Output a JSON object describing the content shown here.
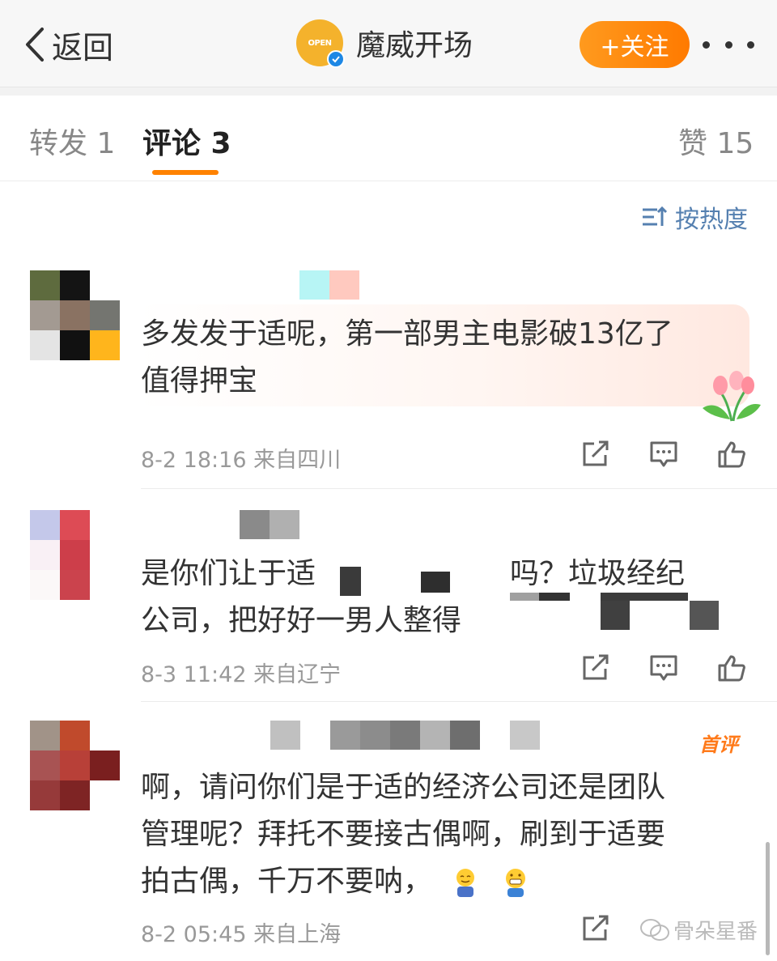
{
  "nav": {
    "back_label": "返回",
    "account_name": "魔威开场",
    "logo_text": "OPEN",
    "follow_label": "+关注"
  },
  "tabs": [
    {
      "label": "转发 1"
    },
    {
      "label": "评论 3"
    },
    {
      "label": "赞 15"
    }
  ],
  "sort_label": "按热度",
  "comments": [
    {
      "lines": [
        "多发发于适呢，第一部男主电影破13亿了",
        "值得押宝"
      ],
      "meta": "8-2 18:16 来自四川"
    },
    {
      "lines": [
        "是你们让于适",
        "公司，把好好一男人整得"
      ],
      "line1_tail": "吗？垃圾经纪",
      "meta": "8-3 11:42 来自辽宁"
    },
    {
      "lines": [
        "啊，请问你们是于适的经济公司还是团队",
        "管理呢？拜托不要接古偶啊，刷到于适要",
        "拍古偶，千万不要呐，"
      ],
      "meta": "8-2 05:45 来自上海",
      "badge": "首评"
    }
  ],
  "watermark": "骨朵星番",
  "colors": {
    "accent": "#ff8200",
    "link_blue": "#5580b0",
    "meta_gray": "#999999"
  },
  "icons": [
    "back-chevron-icon",
    "verified-icon",
    "more-icon",
    "sort-icon",
    "share-icon",
    "comment-icon",
    "like-icon",
    "tulip-sticker-icon",
    "emoji-icon",
    "wechat-icon"
  ]
}
